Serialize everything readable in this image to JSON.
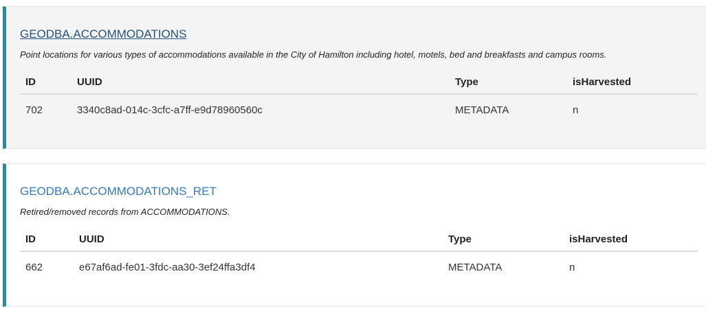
{
  "colors": {
    "accent": "#2d8a99",
    "link": "#337ab7",
    "link_visited": "#23527c"
  },
  "cards": [
    {
      "title": "GEODBA.ACCOMMODATIONS",
      "description": "Point locations for various types of accommodations available in the City of Hamilton including hotel, motels, bed and breakfasts and campus rooms.",
      "columns": [
        "ID",
        "UUID",
        "Type",
        "isHarvested"
      ],
      "rows": [
        {
          "id": "702",
          "uuid": "3340c8ad-014c-3cfc-a7ff-e9d78960560c",
          "type": "METADATA",
          "isHarvested": "n"
        }
      ]
    },
    {
      "title": "GEODBA.ACCOMMODATIONS_RET",
      "description": "Retired/removed records from ACCOMMODATIONS.",
      "columns": [
        "ID",
        "UUID",
        "Type",
        "isHarvested"
      ],
      "rows": [
        {
          "id": "662",
          "uuid": "e67af6ad-fe01-3fdc-aa30-3ef24ffa3df4",
          "type": "METADATA",
          "isHarvested": "n"
        }
      ]
    }
  ]
}
